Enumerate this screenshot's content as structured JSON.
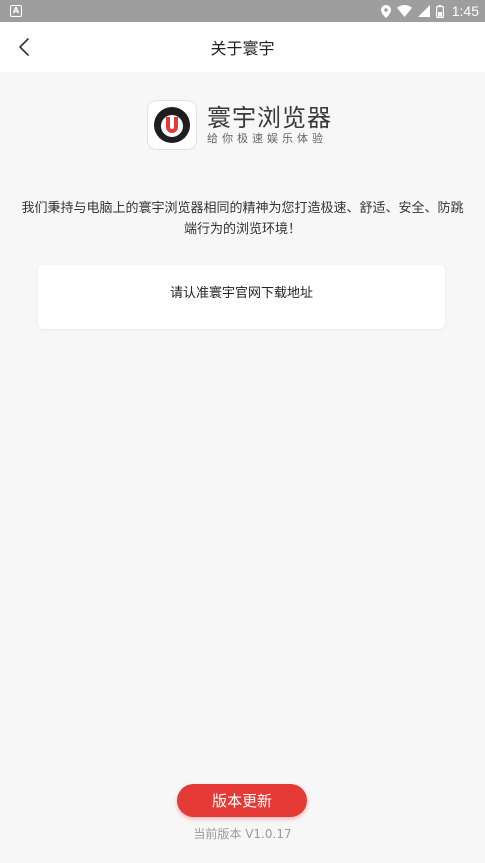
{
  "status_bar": {
    "time": "1:45",
    "icons": [
      "app-notification-icon",
      "location-icon",
      "wifi-icon",
      "signal-icon",
      "battery-icon"
    ]
  },
  "nav": {
    "title": "关于寰宇",
    "back_icon": "chevron-left-icon"
  },
  "brand": {
    "name": "寰宇浏览器",
    "slogan": "给你极速娱乐体验",
    "logo_colors": {
      "ring": "#1e1e1e",
      "letter": "#e53935"
    }
  },
  "description": "我们秉持与电脑上的寰宇浏览器相同的精神为您打造极速、舒适、安全、防跳端行为的浏览环境！",
  "notice_card": {
    "text": "请认准寰宇官网下载地址"
  },
  "update_button": {
    "label": "版本更新",
    "color": "#e53935"
  },
  "version_text": "当前版本 V1.0.17"
}
